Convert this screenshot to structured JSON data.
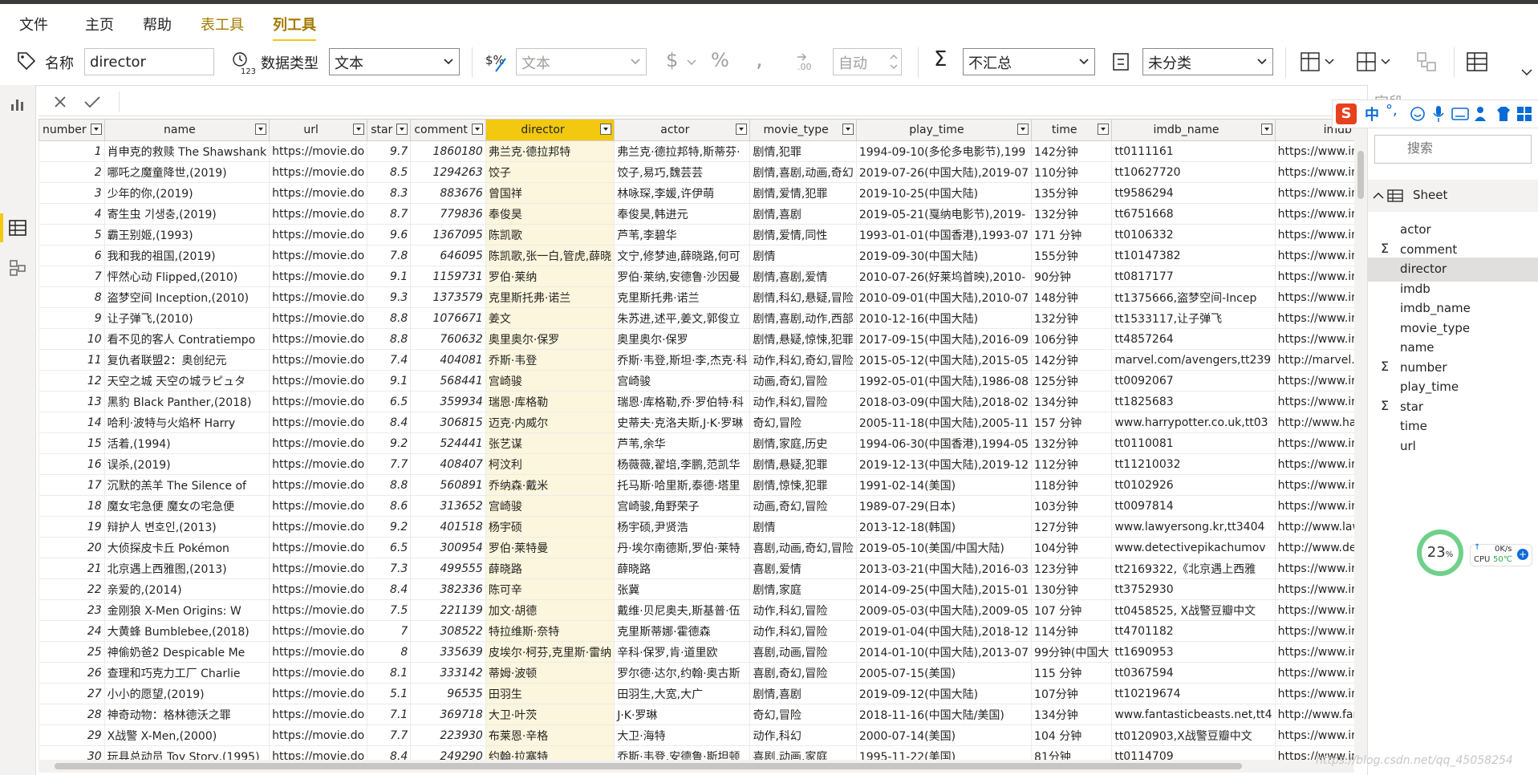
{
  "menu": {
    "items": [
      "文件",
      "主页",
      "帮助",
      "表工具",
      "列工具"
    ]
  },
  "ribbon": {
    "name_label": "名称",
    "name_value": "director",
    "datatype_label": "数据类型",
    "datatype_value": "文本",
    "format_value": "文本",
    "auto_value": "自动",
    "summary_value": "不汇总",
    "category_value": "未分类"
  },
  "grid": {
    "columns": [
      "number",
      "name",
      "url",
      "star",
      "comment",
      "director",
      "actor",
      "movie_type",
      "play_time",
      "time",
      "imdb_name",
      "imdb"
    ],
    "selected_column": "director",
    "rows": [
      [
        "1",
        "肖申克的救赎 The Shawshank",
        "https://movie.do",
        "9.7",
        "1860180",
        "弗兰克·德拉邦特",
        "弗兰克·德拉邦特,斯蒂芬·",
        "剧情,犯罪",
        "1994-09-10(多伦多电影节),199",
        "142分钟",
        "tt0111161",
        "https://www.imdb.com/"
      ],
      [
        "2",
        "哪吒之魔童降世,(2019)",
        "https://movie.do",
        "8.5",
        "1294263",
        "饺子",
        "饺子,易巧,魏芸芸",
        "剧情,喜剧,动画,奇幻",
        "2019-07-26(中国大陆),2019-07",
        "110分钟",
        "tt10627720",
        "https://www.imdb.com/"
      ],
      [
        "3",
        "少年的你,(2019)",
        "https://movie.do",
        "8.3",
        "883676",
        "曾国祥",
        "林咏琛,李媛,许伊萌",
        "剧情,爱情,犯罪",
        "2019-10-25(中国大陆)",
        "135分钟",
        "tt9586294",
        "https://www.imdb.com/"
      ],
      [
        "4",
        "寄生虫 기생충,(2019)",
        "https://movie.do",
        "8.7",
        "779836",
        "奉俊昊",
        "奉俊昊,韩进元",
        "剧情,喜剧",
        "2019-05-21(戛纳电影节),2019-",
        "132分钟",
        "tt6751668",
        "https://www.imdb.com/"
      ],
      [
        "5",
        "霸王别姬,(1993)",
        "https://movie.do",
        "9.6",
        "1367095",
        "陈凯歌",
        "芦苇,李碧华",
        "剧情,爱情,同性",
        "1993-01-01(中国香港),1993-07",
        "171 分钟",
        "tt0106332",
        "https://www.imdb.com/"
      ],
      [
        "6",
        "我和我的祖国,(2019)",
        "https://movie.do",
        "7.8",
        "646095",
        "陈凯歌,张一白,管虎,薛晓",
        "文宁,修梦迪,薛晓路,何可",
        "剧情",
        "2019-09-30(中国大陆)",
        "155分钟",
        "tt10147382",
        "https://www.imdb.com/"
      ],
      [
        "7",
        "怦然心动 Flipped,(2010)",
        "https://movie.do",
        "9.1",
        "1159731",
        "罗伯·莱纳",
        "罗伯·莱纳,安德鲁·沙因曼",
        "剧情,喜剧,爱情",
        "2010-07-26(好莱坞首映),2010-",
        "90分钟",
        "tt0817177",
        "https://www.imdb.com/"
      ],
      [
        "8",
        "盗梦空间 Inception,(2010)",
        "https://movie.do",
        "9.3",
        "1373579",
        "克里斯托弗·诺兰",
        "克里斯托弗·诺兰",
        "剧情,科幻,悬疑,冒险",
        "2010-09-01(中国大陆),2010-07",
        "148分钟",
        "tt1375666,盗梦空间-Incep",
        "https://www.imdb.com/"
      ],
      [
        "9",
        "让子弹飞,(2010)",
        "https://movie.do",
        "8.8",
        "1076671",
        "姜文",
        "朱苏进,述平,姜文,郭俊立",
        "剧情,喜剧,动作,西部",
        "2010-12-16(中国大陆)",
        "132分钟",
        "tt1533117,让子弹飞",
        "https://www.imdb.com/"
      ],
      [
        "10",
        "看不见的客人 Contratiempo",
        "https://movie.do",
        "8.8",
        "760632",
        "奥里奥尔·保罗",
        "奥里奥尔·保罗",
        "剧情,悬疑,惊悚,犯罪",
        "2017-09-15(中国大陆),2016-09",
        "106分钟",
        "tt4857264",
        "https://www.imdb.com/"
      ],
      [
        "11",
        "复仇者联盟2：奥创纪元",
        "https://movie.do",
        "7.4",
        "404081",
        "乔斯·韦登",
        "乔斯·韦登,斯坦·李,杰克·科",
        "动作,科幻,奇幻,冒险",
        "2015-05-12(中国大陆),2015-05",
        "142分钟",
        "marvel.com/avengers,tt239",
        "http://marvel.com/aven"
      ],
      [
        "12",
        "天空之城 天空の城ラピュタ",
        "https://movie.do",
        "9.1",
        "568441",
        "宫崎骏",
        "宫崎骏",
        "动画,奇幻,冒险",
        "1992-05-01(中国大陆),1986-08",
        "125分钟",
        "tt0092067",
        "https://www.imdb.com/"
      ],
      [
        "13",
        "黑豹 Black Panther,(2018)",
        "https://movie.do",
        "6.5",
        "359934",
        "瑞恩·库格勒",
        "瑞恩·库格勒,乔·罗伯特·科",
        "动作,科幻,冒险",
        "2018-03-09(中国大陆),2018-02",
        "134分钟",
        "tt1825683",
        "https://www.imdb.com/"
      ],
      [
        "14",
        "哈利·波特与火焰杯 Harry",
        "https://movie.do",
        "8.4",
        "306815",
        "迈克·内威尔",
        "史蒂夫·克洛夫斯,J·K·罗琳",
        "奇幻,冒险",
        "2005-11-18(中国大陆),2005-11",
        "157 分钟",
        "www.harrypotter.co.uk,tt03",
        "http://www.harrypotter."
      ],
      [
        "15",
        "活着,(1994)",
        "https://movie.do",
        "9.2",
        "524441",
        "张艺谋",
        "芦苇,余华",
        "剧情,家庭,历史",
        "1994-06-30(中国香港),1994-05",
        "132分钟",
        "tt0110081",
        "https://www.imdb.com/"
      ],
      [
        "16",
        "误杀,(2019)",
        "https://movie.do",
        "7.7",
        "408407",
        "柯汶利",
        "杨薇薇,翟培,李鹏,范凯华",
        "剧情,悬疑,犯罪",
        "2019-12-13(中国大陆),2019-12",
        "112分钟",
        "tt11210032",
        "https://www.imdb.com/"
      ],
      [
        "17",
        "沉默的羔羊 The Silence of",
        "https://movie.do",
        "8.8",
        "560891",
        "乔纳森·戴米",
        "托马斯·哈里斯,泰德·塔里",
        "剧情,惊悚,犯罪",
        "1991-02-14(美国)",
        "118分钟",
        "tt0102926",
        "https://www.imdb.com/"
      ],
      [
        "18",
        "魔女宅急便 魔女の宅急便",
        "https://movie.do",
        "8.6",
        "313652",
        "宫崎骏",
        "宫崎骏,角野荣子",
        "动画,奇幻,冒险",
        "1989-07-29(日本)",
        "103分钟",
        "tt0097814",
        "https://www.imdb.com/"
      ],
      [
        "19",
        "辩护人 변호인,(2013)",
        "https://movie.do",
        "9.2",
        "401518",
        "杨宇硕",
        "杨宇硕,尹贤浩",
        "剧情",
        "2013-12-18(韩国)",
        "127分钟",
        "www.lawyersong.kr,tt3404",
        "http://www.lawyersong."
      ],
      [
        "20",
        "大侦探皮卡丘 Pokémon",
        "https://movie.do",
        "6.5",
        "300954",
        "罗伯·莱特曼",
        "丹·埃尔南德斯,罗伯·莱特",
        "喜剧,动画,奇幻,冒险",
        "2019-05-10(美国/中国大陆)",
        "104分钟",
        "www.detectivepikachumov",
        "http://www.detectivepik"
      ],
      [
        "21",
        "北京遇上西雅图,(2013)",
        "https://movie.do",
        "7.3",
        "499555",
        "薛晓路",
        "薛晓路",
        "喜剧,爱情",
        "2013-03-21(中国大陆),2016-03",
        "123分钟",
        "tt2169322,《北京遇上西雅",
        "https://www.imdb.com/"
      ],
      [
        "22",
        "亲爱的,(2014)",
        "https://movie.do",
        "8.4",
        "382336",
        "陈可辛",
        "张冀",
        "剧情,家庭",
        "2014-09-25(中国大陆),2015-01",
        "130分钟",
        "tt3752930",
        "https://www.imdb.com/"
      ],
      [
        "23",
        "金刚狼 X-Men Origins: W",
        "https://movie.do",
        "7.5",
        "221139",
        "加文·胡德",
        "戴维·贝尼奥夫,斯基普·伍",
        "动作,科幻,冒险",
        "2009-05-03(中国大陆),2009-05",
        "107 分钟",
        "tt0458525, X战警豆瓣中文",
        "https://www.imdb.com/"
      ],
      [
        "24",
        "大黄蜂 Bumblebee,(2018)",
        "https://movie.do",
        "7",
        "308522",
        "特拉维斯·奈特",
        "克里斯蒂娜·霍德森",
        "动作,科幻,冒险",
        "2019-01-04(中国大陆),2018-12",
        "114分钟",
        "tt4701182",
        "https://www.imdb.com/"
      ],
      [
        "25",
        "神偷奶爸2 Despicable Me",
        "https://movie.do",
        "8",
        "335639",
        "皮埃尔·柯芬,克里斯·雷纳",
        "辛科·保罗,肯·道里欧",
        "喜剧,动画,冒险",
        "2014-01-10(中国大陆),2013-07",
        "99分钟(中国大",
        "tt1690953",
        "https://www.imdb.com/"
      ],
      [
        "26",
        "查理和巧克力工厂 Charlie",
        "https://movie.do",
        "8.1",
        "333142",
        "蒂姆·波顿",
        "罗尔德·达尔,约翰·奥古斯",
        "喜剧,奇幻,冒险",
        "2005-07-15(美国)",
        "115 分钟",
        "tt0367594",
        "https://www.imdb.com/"
      ],
      [
        "27",
        "小小的愿望,(2019)",
        "https://movie.do",
        "5.1",
        "96535",
        "田羽生",
        "田羽生,大宽,大广",
        "剧情,喜剧",
        "2019-09-12(中国大陆)",
        "107分钟",
        "tt10219674",
        "https://www.imdb.com/"
      ],
      [
        "28",
        "神奇动物：格林德沃之罪",
        "https://movie.do",
        "7.1",
        "369718",
        "大卫·叶茨",
        "J·K·罗琳",
        "奇幻,冒险",
        "2018-11-16(中国大陆/美国)",
        "134分钟",
        "www.fantasticbeasts.net,tt4",
        "http://www.fantasticbea"
      ],
      [
        "29",
        "X战警 X-Men,(2000)",
        "https://movie.do",
        "7.7",
        "223930",
        "布莱恩·辛格",
        "大卫·海特",
        "动作,科幻",
        "2000-07-14(美国)",
        "104 分钟",
        "tt0120903,X战警豆瓣中文",
        "https://www.imdb.com/"
      ],
      [
        "30",
        "玩具总动员 Toy Story,(1995)",
        "https://movie.do",
        "8.4",
        "249290",
        "约翰·拉塞特",
        "乔斯·韦登,安德鲁·斯坦顿",
        "喜剧,动画,家庭",
        "1995-11-22(美国)",
        "81分钟",
        "tt0114709",
        "https://www.imdb.com/"
      ]
    ]
  },
  "fields_pane": {
    "title": "字段",
    "search_placeholder": "搜索",
    "table_name": "Sheet",
    "fields": [
      {
        "name": "actor",
        "sum": false
      },
      {
        "name": "comment",
        "sum": true
      },
      {
        "name": "director",
        "sum": false,
        "selected": true
      },
      {
        "name": "imdb",
        "sum": false
      },
      {
        "name": "imdb_name",
        "sum": false
      },
      {
        "name": "movie_type",
        "sum": false
      },
      {
        "name": "name",
        "sum": false
      },
      {
        "name": "number",
        "sum": true
      },
      {
        "name": "play_time",
        "sum": false
      },
      {
        "name": "star",
        "sum": true
      },
      {
        "name": "time",
        "sum": false
      },
      {
        "name": "url",
        "sum": false
      }
    ]
  },
  "ime": {
    "label": "中"
  },
  "cpu_widget": {
    "percent": "23",
    "percent_unit": "%",
    "speed": "0K/s",
    "cpu_label": "CPU",
    "temp": "50℃"
  },
  "watermark": "https://blog.csdn.net/qq_45058254",
  "colors": {
    "accent": "#f2c811",
    "context_tab": "#a47a00"
  }
}
